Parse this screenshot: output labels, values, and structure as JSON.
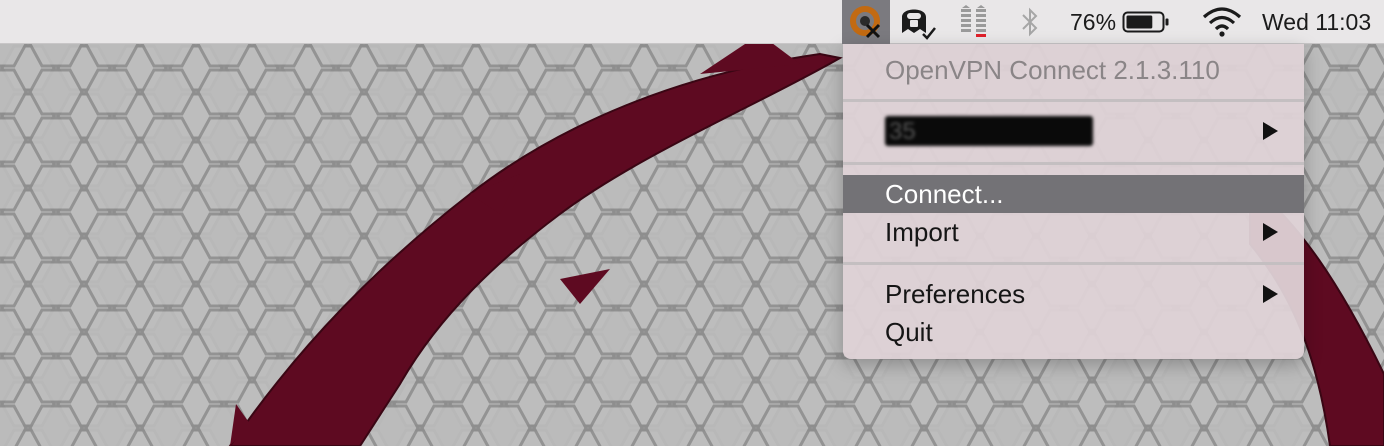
{
  "menubar": {
    "battery_percent": "76%",
    "battery_level": 0.76,
    "clock": "Wed 11:03",
    "icons": [
      "openvpn-icon",
      "pia-icon",
      "network-meter-icon",
      "bluetooth-icon",
      "battery-icon",
      "wifi-icon"
    ]
  },
  "menu": {
    "header": "OpenVPN Connect 2.1.3.110",
    "profile_label": "35",
    "items": {
      "connect": "Connect...",
      "import": "Import",
      "preferences": "Preferences",
      "quit": "Quit"
    }
  },
  "colors": {
    "menubar_bg": "#e9e7e8",
    "menu_bg": "#ded2d6",
    "selected_bg": "#737276",
    "wallpaper_swoosh": "#5e0a21",
    "meter_red": "#e0202a"
  }
}
